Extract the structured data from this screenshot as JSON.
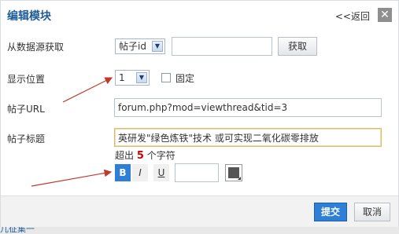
{
  "dialog": {
    "title": "编辑模块",
    "back_label": "<<返回",
    "close_label": "✕"
  },
  "fields": {
    "source": {
      "label": "从数据源获取",
      "select_value": "帖子id",
      "input_value": "",
      "button_label": "获取"
    },
    "position": {
      "label": "显示位置",
      "select_value": "1",
      "checkbox_label": "固定",
      "checked": false
    },
    "url": {
      "label": "帖子URL",
      "value": "forum.php?mod=viewthread&tid=3"
    },
    "post_title": {
      "label": "帖子标题",
      "value": "英研发\"绿色炼铁\"技术 或可实现二氧化碳零排放",
      "hint_prefix": "超出",
      "hint_count": "5",
      "hint_suffix": "个字符"
    },
    "format": {
      "bold_label": "B",
      "italic_label": "I",
      "underline_label": "U",
      "size_value": "",
      "color": "#555555"
    }
  },
  "footer": {
    "submit_label": "提交",
    "cancel_label": "取消"
  },
  "background": {
    "peek_text": "儿征集一"
  },
  "colors": {
    "accent": "#2e7fd6",
    "title": "#1f5d99",
    "annotation_arrow": "#c0392b",
    "warning_number": "#cc0000"
  }
}
